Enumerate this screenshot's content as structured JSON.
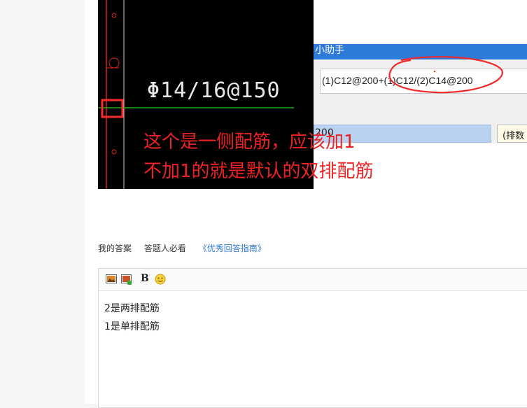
{
  "composite": {
    "cad_label": "Φ14/16@150",
    "dialog_title": "小助手",
    "dialog_input_value": "(1)C12@200+(1)C12/(2)C14@200",
    "dialog_list_value": "200",
    "dialog_tip_value": "(排数",
    "annotation_line1": "这个是一侧配筋，应该加1",
    "annotation_line2": "不加1的就是默认的双排配筋"
  },
  "answer_tabs": {
    "my_answer": "我的答案",
    "must_read": "答题人必看",
    "guide_link": "《优秀回答指南》"
  },
  "editor": {
    "lines": [
      "2是两排配筋",
      "1是单排配筋"
    ]
  },
  "colors": {
    "annotation_red": "#ee2222",
    "link_blue": "#2f79d6",
    "dialog_title_blue": "#2f7bd9"
  }
}
